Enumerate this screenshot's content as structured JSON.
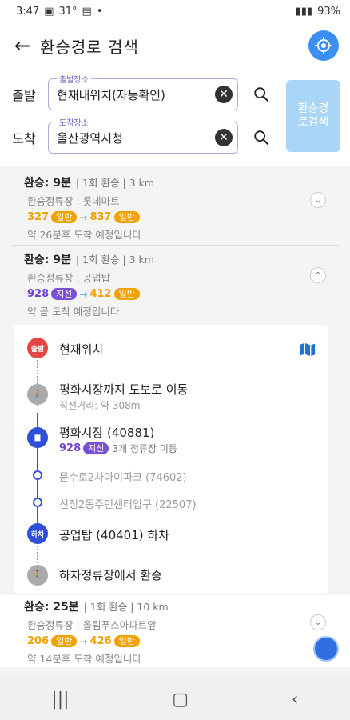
{
  "status": {
    "time": "3:47",
    "temp": "31°",
    "battery": "93%"
  },
  "header": {
    "title": "환승경로 검색"
  },
  "search": {
    "origin_label": "출발",
    "origin_field_label": "출발장소",
    "origin_value": "현재내위치(자동확인)",
    "dest_label": "도착",
    "dest_field_label": "도착장소",
    "dest_value": "울산광역시청",
    "button": "환승경로검색"
  },
  "routes": [
    {
      "head": "환승: 9분",
      "meta": "| 1회 환승 | 3 km",
      "stop": "환승정류장 : 롯데마트",
      "bus1": "327",
      "tag1": "일반",
      "bus2": "837",
      "tag2": "일반",
      "eta": "약 26분후 도착 예정입니다"
    },
    {
      "head": "환승: 9분",
      "meta": "| 1회 환승 | 3 km",
      "stop": "환승정류장 : 공업탑",
      "bus1": "928",
      "tag1": "지선",
      "bus2": "412",
      "tag2": "일반",
      "eta": "약 곧 도착 예정입니다"
    },
    {
      "head": "환승: 25분",
      "meta": "| 1회 환승 | 10 km",
      "stop": "환승정류장 : 올림푸스아파트앞",
      "bus1": "206",
      "tag1": "일반",
      "bus2": "426",
      "tag2": "일반",
      "eta": "약 14분후 도착 예정입니다"
    }
  ],
  "detail": {
    "origin_badge": "출발",
    "origin": "현재위치",
    "walk1": "평화시장까지 도보로 이동",
    "walk1_sub": "직선거리: 약 308m",
    "board_stop": "평화시장 (40881)",
    "board_bus": "928",
    "board_tag": "지선",
    "board_info": "3개 정류장 이동",
    "mid1": "문수로2차아이파크 (74602)",
    "mid2": "신정2동주민센터입구 (22507)",
    "alight_badge": "하차",
    "alight_stop": "공업탑 (40401) 하차",
    "walk2": "하차정류장에서 환승"
  }
}
